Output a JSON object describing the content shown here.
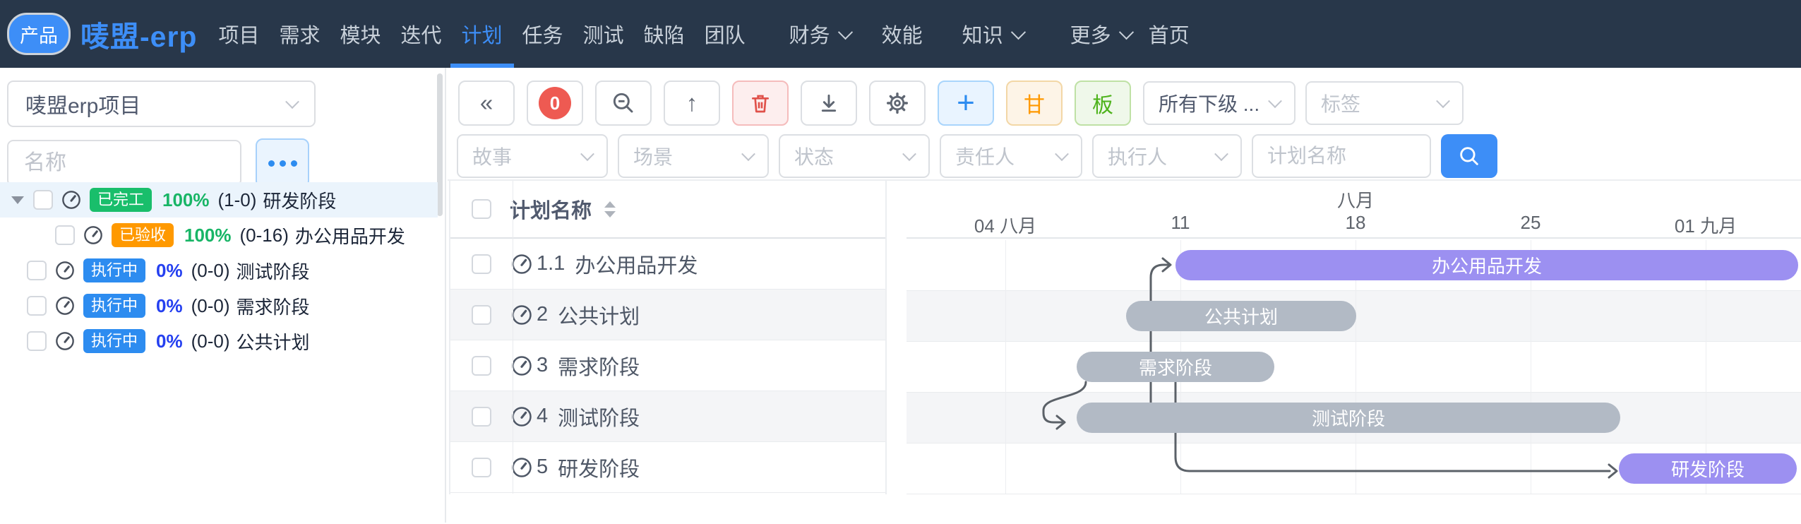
{
  "nav": {
    "product_badge": "产品",
    "title": "唛盟-erp",
    "items": [
      {
        "label": "项目"
      },
      {
        "label": "需求"
      },
      {
        "label": "模块"
      },
      {
        "label": "迭代"
      },
      {
        "label": "计划",
        "active": true
      },
      {
        "label": "任务"
      },
      {
        "label": "测试"
      },
      {
        "label": "缺陷"
      },
      {
        "label": "团队"
      },
      {
        "label": "财务",
        "dropdown": true
      },
      {
        "label": "效能"
      },
      {
        "label": "知识",
        "dropdown": true
      },
      {
        "label": "更多",
        "dropdown": true
      },
      {
        "label": "首页"
      }
    ],
    "accent_color": "#3d8ef7",
    "background_color": "#28374a"
  },
  "sidebar": {
    "project_select": {
      "value": "唛盟erp项目"
    },
    "name_input": {
      "placeholder": "名称"
    },
    "more_button_icon": "ellipsis-icon",
    "tree": [
      {
        "status": "已完工",
        "status_color": "#19be6b",
        "percent": "100%",
        "percent_color": "#18b566",
        "range": "(1-0)",
        "name": "研发阶段",
        "selected": true
      },
      {
        "status": "已验收",
        "status_color": "#ff9900",
        "percent": "100%",
        "percent_color": "#18b566",
        "range": "(0-16)",
        "name": "办公用品开发",
        "indented": true
      },
      {
        "status": "执行中",
        "status_color": "#2d8cf0",
        "percent": "0%",
        "percent_color": "#2540f0",
        "range": "(0-0)",
        "name": "测试阶段"
      },
      {
        "status": "执行中",
        "status_color": "#2d8cf0",
        "percent": "0%",
        "percent_color": "#2540f0",
        "range": "(0-0)",
        "name": "需求阶段"
      },
      {
        "status": "执行中",
        "status_color": "#2d8cf0",
        "percent": "0%",
        "percent_color": "#2540f0",
        "range": "(0-0)",
        "name": "公共计划"
      }
    ]
  },
  "toolbar": {
    "count_badge": "0",
    "gantt_button_label": "甘",
    "board_button_label": "板",
    "scope_select_value": "所有下级 ...",
    "tag_select_placeholder": "标签",
    "icons": [
      "collapse-double-left-icon",
      "count-badge",
      "zoom-out-icon",
      "arrow-up-icon",
      "trash-icon",
      "download-icon",
      "gear-icon",
      "plus-icon"
    ]
  },
  "filters": {
    "story_placeholder": "故事",
    "scene_placeholder": "场景",
    "status_placeholder": "状态",
    "owner_placeholder": "责任人",
    "executor_placeholder": "执行人",
    "plan_name_placeholder": "计划名称",
    "search_icon": "search-icon",
    "search_color": "#3d8ef7"
  },
  "table": {
    "header": "计划名称",
    "rows": [
      {
        "no": "1.1",
        "name": "办公用品开发"
      },
      {
        "no": "2",
        "name": "公共计划"
      },
      {
        "no": "3",
        "name": "需求阶段"
      },
      {
        "no": "4",
        "name": "测试阶段"
      },
      {
        "no": "5",
        "name": "研发阶段"
      }
    ]
  },
  "gantt": {
    "month_label": "八月",
    "week_labels": [
      "04 八月",
      "11",
      "18",
      "25",
      "01 九月"
    ],
    "bars": [
      {
        "label": "办公用品开发",
        "row": 1,
        "color": "#9c90f1"
      },
      {
        "label": "公共计划",
        "row": 2,
        "color": "#b2bac5"
      },
      {
        "label": "需求阶段",
        "row": 3,
        "color": "#b2bac5"
      },
      {
        "label": "测试阶段",
        "row": 4,
        "color": "#b2bac5"
      },
      {
        "label": "研发阶段",
        "row": 5,
        "color": "#9c90f1"
      }
    ],
    "dependencies": [
      {
        "from": "测试阶段",
        "to": "办公用品开发"
      },
      {
        "from": "需求阶段",
        "to": "测试阶段"
      },
      {
        "from": "需求阶段",
        "to": "研发阶段"
      }
    ],
    "colors": {
      "milestone_purple": "#9c90f1",
      "milestone_gray": "#b2bac5",
      "dependency_line": "#5b6168"
    }
  }
}
